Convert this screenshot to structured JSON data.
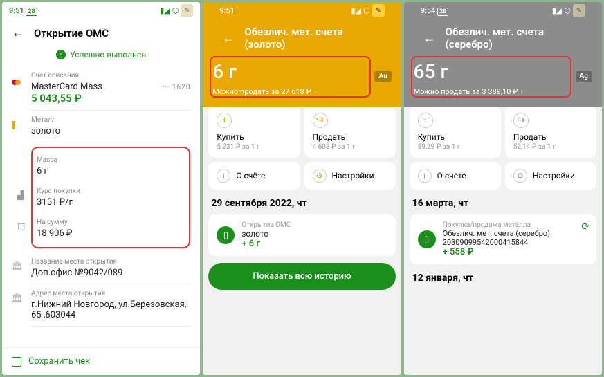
{
  "s1": {
    "time": "9:51",
    "date": "28",
    "title": "Открытие ОМС",
    "status": "Успешно выполнен",
    "debit_lbl": "Счет списания",
    "card_name": "MasterCard Mass",
    "card_mask": "···· 1620",
    "balance": "5 043,55 ₽",
    "metal_lbl": "Металл",
    "metal": "золото",
    "mass_lbl": "Масса",
    "mass": "6 г",
    "rate_lbl": "Курс покупки",
    "rate": "3151 ₽/г",
    "sum_lbl": "На сумму",
    "sum": "18 906 ₽",
    "place_lbl": "Название места открытия",
    "place": "Доп.офис №9042/089",
    "addr_lbl": "Адрес места открытия",
    "addr": "г.Нижний Новгород, ул.Березовская, 65 ,603044",
    "save": "Сохранить чек"
  },
  "s2": {
    "time": "9:51",
    "title": "Обезлич. мет. счета (золото)",
    "amount": "6 г",
    "badge": "Au",
    "sell": "Можно продать за 27 618 ₽",
    "buy_lbl": "Купить",
    "buy_sub": "5 231 ₽ за 1 г",
    "sell_lbl": "Продать",
    "sell_sub": "4 603 ₽ за 1 г",
    "about": "О счёте",
    "settings": "Настройки",
    "date": "29 сентября 2022, чт",
    "txn_l1": "Открытие ОМС",
    "txn_l2": "золото",
    "txn_l3": "+ 6 г",
    "btn": "Показать всю историю"
  },
  "s3": {
    "time": "9:54",
    "date": "28",
    "title": "Обезлич. мет. счета (серебро)",
    "amount": "65 г",
    "badge": "Ag",
    "sell": "Можно продать за 3 389,10 ₽",
    "buy_lbl": "Купить",
    "buy_sub": "59,29 ₽ за 1 г",
    "sell_lbl": "Продать",
    "sell_sub": "52,14 ₽ за 1 г",
    "about": "О счёте",
    "settings": "Настройки",
    "date1": "16 марта, чт",
    "txn_l1": "Покупка/продажа металла",
    "txn_l2": "Обезлич. мет. счета (серебро) 20309099542000415844",
    "txn_l3": "+ 558 ₽",
    "date2": "12 января, чт"
  }
}
